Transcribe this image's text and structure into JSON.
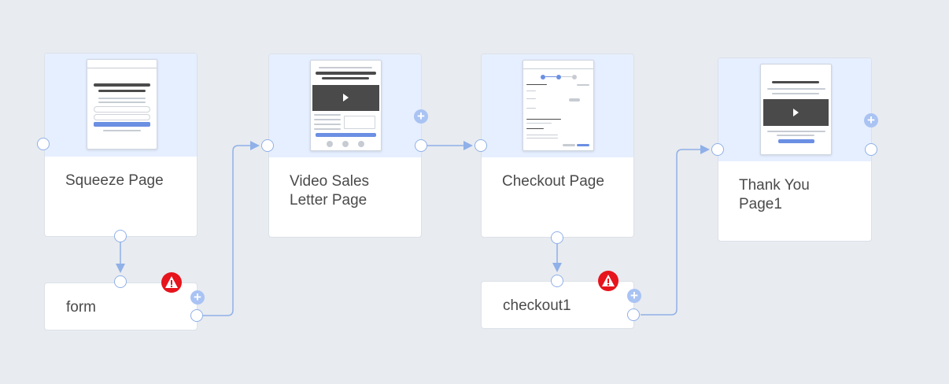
{
  "steps": [
    {
      "name": "Squeeze Page"
    },
    {
      "name": "Video Sales\nLetter Page"
    },
    {
      "name": "Checkout Page"
    },
    {
      "name": "Thank You\nPage1"
    }
  ],
  "elements": [
    {
      "name": "form"
    },
    {
      "name": "checkout1"
    }
  ],
  "colors": {
    "background": "#e8ebf0",
    "connector": "#8fb0e8",
    "warning": "#e6141c",
    "accent": "#6b8fe3"
  },
  "icons": [
    "plus-icon",
    "warning-icon",
    "play-icon"
  ]
}
